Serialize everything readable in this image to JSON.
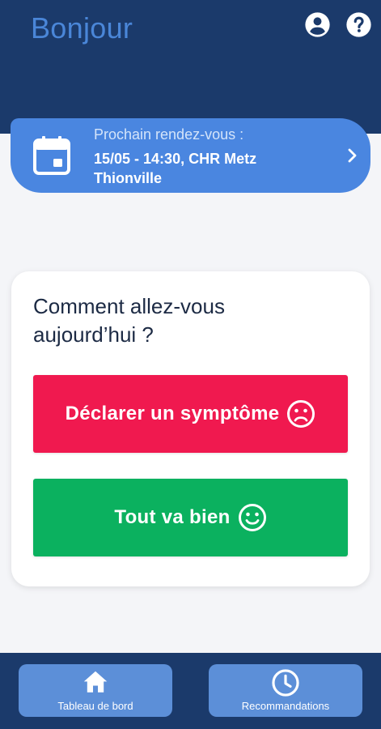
{
  "header": {
    "greeting": "Bonjour",
    "profile_icon": "account-circle-icon",
    "help_icon": "help-circle-icon"
  },
  "appointment": {
    "label": "Prochain rendez-vous :",
    "value": "15/05 - 14:30, CHR Metz Thionville",
    "icon": "calendar-icon"
  },
  "checkin": {
    "question": "Comment allez-vous aujourd’hui ?",
    "symptom_button": "Déclarer un symptôme",
    "fine_button": "Tout va bien"
  },
  "bottom_nav": {
    "dashboard_label": "Tableau de bord",
    "recommendations_label": "Recommandations"
  },
  "colors": {
    "header_bg": "#1b3a6b",
    "greeting": "#4a86d8",
    "appointment_bg": "#4a86e0",
    "symptom": "#f0194f",
    "fine": "#0bb15f",
    "nav_button": "#5c8fd8"
  }
}
